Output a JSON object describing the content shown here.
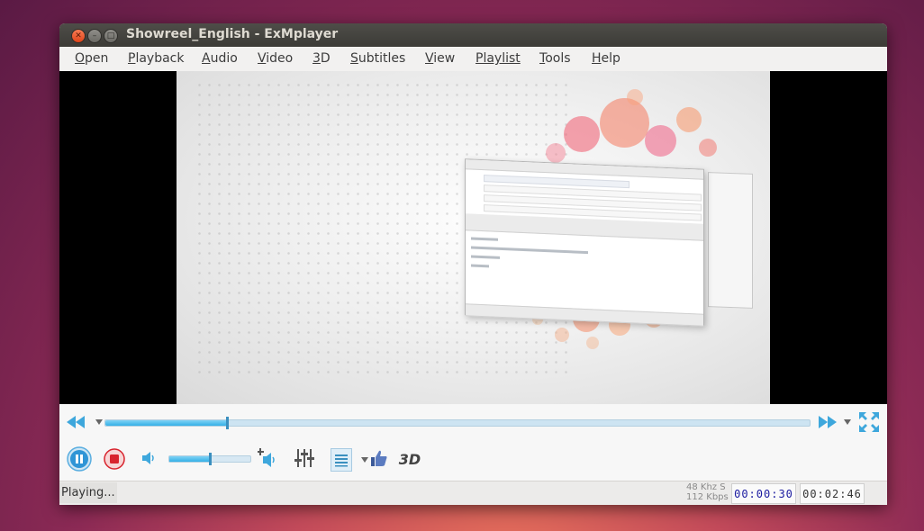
{
  "window": {
    "title": "Showreel_English - ExMplayer"
  },
  "menu": [
    {
      "label": "Open",
      "accel": "O",
      "rest": "pen"
    },
    {
      "label": "Playback",
      "accel": "P",
      "rest": "layback"
    },
    {
      "label": "Audio",
      "accel": "A",
      "rest": "udio"
    },
    {
      "label": "Video",
      "accel": "V",
      "rest": "ideo"
    },
    {
      "label": "3D",
      "accel": "3",
      "rest": "D"
    },
    {
      "label": "Subtitles",
      "accel": "S",
      "rest": "ubtitles"
    },
    {
      "label": "View",
      "accel": "V",
      "rest": "iew"
    },
    {
      "label": "Playlist",
      "accel": "",
      "rest": "Playlist"
    },
    {
      "label": "Tools",
      "accel": "T",
      "rest": "ools"
    },
    {
      "label": "Help",
      "accel": "H",
      "rest": "elp"
    }
  ],
  "controls": {
    "seek_progress_fraction": 0.172,
    "volume_fraction": 0.5,
    "three_d_label": "3D"
  },
  "status": {
    "text": "Playing...",
    "audio_rate": "48 Khz S",
    "audio_bitrate": "112 Kbps",
    "current_time": "00:00:30",
    "total_time": "00:02:46"
  },
  "colors": {
    "accent": "#35b0e6",
    "stop_red": "#d8242e",
    "time_current": "#1a1aa0",
    "time_total": "#333333"
  }
}
